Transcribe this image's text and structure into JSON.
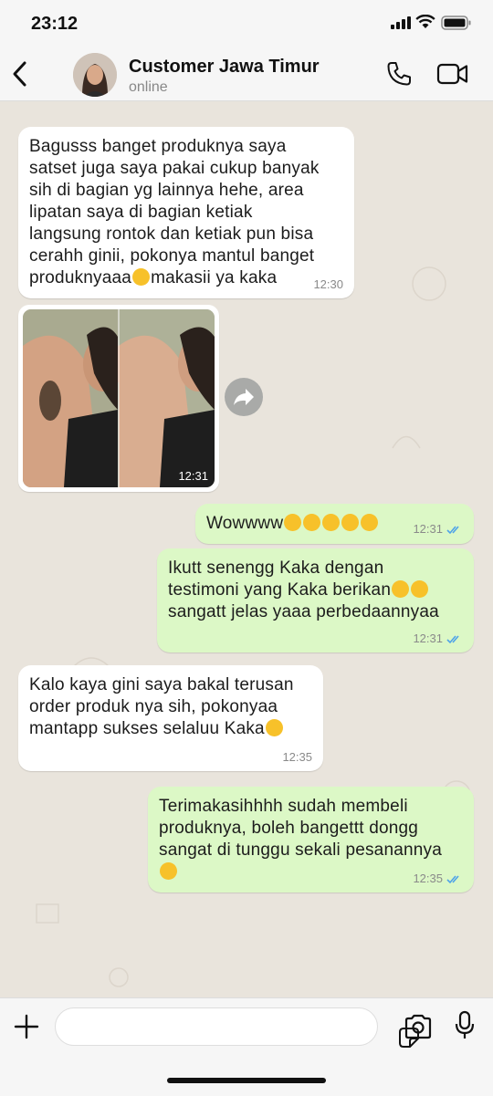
{
  "status_bar": {
    "time": "23:12"
  },
  "header": {
    "contact_name": "Customer Jawa Timur",
    "status": "online"
  },
  "messages": [
    {
      "type": "incoming",
      "time": "12:30"
    },
    {
      "type": "incoming-image",
      "time": "12:31"
    },
    {
      "type": "outgoing",
      "time": "12:31"
    },
    {
      "type": "outgoing",
      "time": "12:31"
    },
    {
      "type": "incoming",
      "time": "12:35"
    },
    {
      "type": "outgoing",
      "time": "12:35"
    }
  ],
  "text": {
    "m1_l1": "Bagusss banget produknya saya",
    "m1_l2": "satset juga saya pakai cukup banyak",
    "m1_l3": "sih di bagian yg lainnya hehe, area",
    "m1_l4": "lipatan saya di bagian ketiak",
    "m1_l5": "langsung rontok dan ketiak pun bisa",
    "m1_l6": "cerahh ginii, pokonya mantul banget",
    "m1_l7a": "produknyaaa",
    "m1_l7b": "makasii ya kaka",
    "m3": "Wowwww",
    "m4_l1": "Ikutt senengg Kaka dengan",
    "m4_l2": "testimoni yang Kaka berikan",
    "m4_l3": "sangatt jelas yaaa perbedaannyaa",
    "m5_l1": "Kalo kaya gini saya bakal terusan",
    "m5_l2": "order produk nya sih, pokonyaa",
    "m5_l3": "mantapp sukses selaluu Kaka",
    "m6_l1": "Terimakasihhhh sudah membeli",
    "m6_l2": "produknya, boleh bangettt dongg",
    "m6_l3": "sangat di tunggu sekali pesanannya"
  },
  "icons": {
    "back": "chevron-left-icon",
    "call": "phone-icon",
    "video": "video-camera-icon",
    "forward": "forward-arrow-icon",
    "plus": "plus-icon",
    "sticker": "sticker-icon",
    "camera": "camera-icon",
    "mic": "microphone-icon",
    "read_receipt": "double-check-icon"
  },
  "colors": {
    "outgoing_bubble": "#dcf8c6",
    "incoming_bubble": "#ffffff",
    "chat_background": "#e9e4dc",
    "read_check": "#4fa3e8",
    "emoji": "#f7c12a"
  }
}
